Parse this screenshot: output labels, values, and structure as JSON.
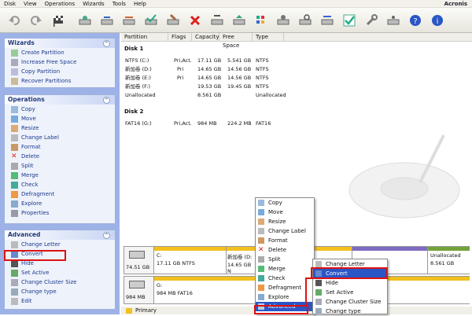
{
  "menu": [
    "Disk",
    "View",
    "Operations",
    "Wizards",
    "Tools",
    "Help"
  ],
  "brand": "Acronis",
  "wizards": {
    "title": "Wizards",
    "items": [
      "Create Partition",
      "Increase Free Space",
      "Copy Partition",
      "Recover Partitions"
    ]
  },
  "operations": {
    "title": "Operations",
    "items": [
      "Copy",
      "Move",
      "Resize",
      "Change Label",
      "Format",
      "Delete",
      "Split",
      "Merge",
      "Check",
      "Defragment",
      "Explore",
      "Properties"
    ]
  },
  "advanced": {
    "title": "Advanced",
    "items": [
      "Change Letter",
      "Convert",
      "Hide",
      "Set Active",
      "Change Cluster Size",
      "Change type",
      "Edit"
    ]
  },
  "columns": [
    "Partition",
    "Flags",
    "Capacity",
    "Free Space",
    "Type"
  ],
  "disk1": {
    "label": "Disk 1",
    "rows": [
      {
        "name": "NTFS (C:)",
        "flags": "Pri,Act.",
        "cap": "17.11 GB",
        "free": "5.541 GB",
        "type": "NTFS"
      },
      {
        "name": "新加卷 (D:)",
        "flags": "Pri",
        "cap": "14.65 GB",
        "free": "14.56 GB",
        "type": "NTFS"
      },
      {
        "name": "新加卷 (E:)",
        "flags": "Pri",
        "cap": "14.65 GB",
        "free": "14.56 GB",
        "type": "NTFS"
      },
      {
        "name": "新加卷 (F:)",
        "flags": "",
        "cap": "19.53 GB",
        "free": "19.45 GB",
        "type": "NTFS"
      },
      {
        "name": "Unallocated",
        "flags": "",
        "cap": "8.561 GB",
        "free": "",
        "type": "Unallocated"
      }
    ]
  },
  "disk2": {
    "label": "Disk 2",
    "rows": [
      {
        "name": "FAT16 (G:)",
        "flags": "Pri,Act.",
        "cap": "984 MB",
        "free": "224.2 MB",
        "type": "FAT16"
      }
    ]
  },
  "map1": {
    "size": "74.51 GB",
    "c_label": "C:",
    "c_info": "17.11 GB  NTFS",
    "d_label": "新加卷 (D:",
    "d_info": "14.65 GB N",
    "un_label": "Unallocated",
    "un_info": "8.561 GB"
  },
  "map2": {
    "size": "984 MB",
    "g_label": "G:",
    "g_info": "984 MB  FAT16"
  },
  "ctx1": [
    "Copy",
    "Move",
    "Resize",
    "Change Label",
    "Format",
    "Delete",
    "Split",
    "Merge",
    "Check",
    "Defragment",
    "Explore",
    "Advanced"
  ],
  "ctx2": [
    "Change Letter",
    "Convert",
    "Hide",
    "Set Active",
    "Change Cluster Size",
    "Change type"
  ],
  "legend": {
    "primary": "Primary"
  },
  "colors": {
    "accent": "#2a56c6",
    "highlight": "#d11111",
    "panel": "#9db2e6"
  }
}
